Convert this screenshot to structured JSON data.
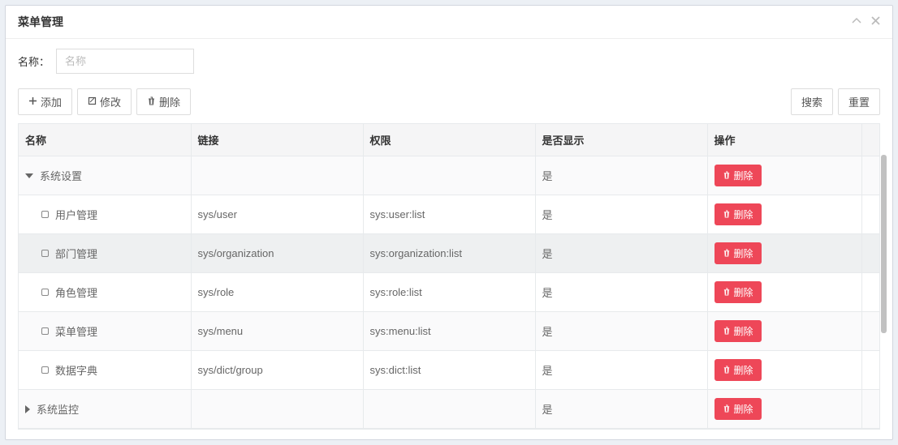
{
  "panel": {
    "title": "菜单管理"
  },
  "filter": {
    "label": "名称：",
    "placeholder": "名称"
  },
  "toolbar": {
    "add": "添加",
    "edit": "修改",
    "del": "删除",
    "search": "搜索",
    "reset": "重置"
  },
  "columns": {
    "name": "名称",
    "link": "链接",
    "perm": "权限",
    "show": "是否显示",
    "action": "操作"
  },
  "rows": [
    {
      "name": "系统设置",
      "link": "",
      "perm": "",
      "show": "是",
      "indent": 0,
      "expander": "expanded",
      "highlight": false
    },
    {
      "name": "用户管理",
      "link": "sys/user",
      "perm": "sys:user:list",
      "show": "是",
      "indent": 1,
      "expander": "leaf",
      "highlight": false
    },
    {
      "name": "部门管理",
      "link": "sys/organization",
      "perm": "sys:organization:list",
      "show": "是",
      "indent": 1,
      "expander": "leaf",
      "highlight": true
    },
    {
      "name": "角色管理",
      "link": "sys/role",
      "perm": "sys:role:list",
      "show": "是",
      "indent": 1,
      "expander": "leaf",
      "highlight": false
    },
    {
      "name": "菜单管理",
      "link": "sys/menu",
      "perm": "sys:menu:list",
      "show": "是",
      "indent": 1,
      "expander": "leaf",
      "highlight": false
    },
    {
      "name": "数据字典",
      "link": "sys/dict/group",
      "perm": "sys:dict:list",
      "show": "是",
      "indent": 1,
      "expander": "leaf",
      "highlight": false
    },
    {
      "name": "系统监控",
      "link": "",
      "perm": "",
      "show": "是",
      "indent": 0,
      "expander": "collapsed",
      "highlight": false
    }
  ],
  "rowDelete": "删除"
}
